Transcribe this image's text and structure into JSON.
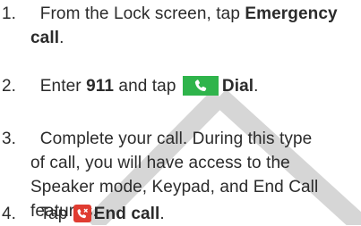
{
  "steps": [
    {
      "number": "1.",
      "text_before": "From the Lock screen, tap ",
      "bold": "Emergency",
      "line2_bold": "call",
      "line2_after": "."
    },
    {
      "number": "2.",
      "text_before": "Enter ",
      "bold1": "911",
      "text_mid": " and tap ",
      "icon": "phone-icon",
      "bold2": "Dial",
      "text_after": "."
    },
    {
      "number": "3.",
      "lines": [
        "Complete your call. During this type",
        "of call, you will have access to the",
        "Speaker mode, Keypad, and End Call",
        "features."
      ]
    },
    {
      "number": "4.",
      "text_before": "Tap ",
      "icon": "end-call-icon",
      "bold": "End call",
      "text_after": "."
    }
  ],
  "colors": {
    "dial_green": "#2fb44b",
    "end_call_red": "#e03c31",
    "text": "#2b2b2b",
    "watermark": "#d8d8d8"
  }
}
